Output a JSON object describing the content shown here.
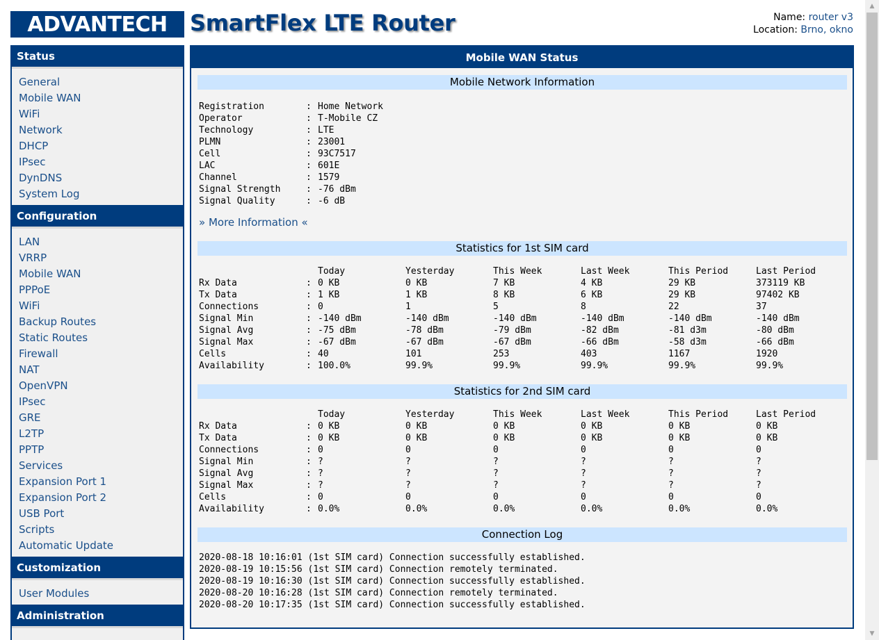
{
  "header": {
    "logo_text": "ADVANTECH",
    "app_title": "SmartFlex LTE Router",
    "name_label": "Name:",
    "name_value": "router v3",
    "location_label": "Location:",
    "location_value": "Brno, okno"
  },
  "sidebar": {
    "sections": [
      {
        "title": "Status",
        "items": [
          "General",
          "Mobile WAN",
          "WiFi",
          "Network",
          "DHCP",
          "IPsec",
          "DynDNS",
          "System Log"
        ]
      },
      {
        "title": "Configuration",
        "items": [
          "LAN",
          "VRRP",
          "Mobile WAN",
          "PPPoE",
          "WiFi",
          "Backup Routes",
          "Static Routes",
          "Firewall",
          "NAT",
          "OpenVPN",
          "IPsec",
          "GRE",
          "L2TP",
          "PPTP",
          "Services",
          "Expansion Port 1",
          "Expansion Port 2",
          "USB Port",
          "Scripts",
          "Automatic Update"
        ]
      },
      {
        "title": "Customization",
        "items": [
          "User Modules"
        ]
      },
      {
        "title": "Administration",
        "items": []
      }
    ]
  },
  "main": {
    "title": "Mobile WAN Status",
    "network_info": {
      "title": "Mobile Network Information",
      "rows": [
        {
          "label": "Registration",
          "value": "Home Network"
        },
        {
          "label": "Operator",
          "value": "T-Mobile CZ"
        },
        {
          "label": "Technology",
          "value": "LTE"
        },
        {
          "label": "PLMN",
          "value": "23001"
        },
        {
          "label": "Cell",
          "value": "93C7517"
        },
        {
          "label": "LAC",
          "value": "601E"
        },
        {
          "label": "Channel",
          "value": "1579"
        },
        {
          "label": "Signal Strength",
          "value": "-76 dBm"
        },
        {
          "label": "Signal Quality",
          "value": "-6 dB"
        }
      ],
      "more_link": "» More Information «"
    },
    "stat_columns": [
      "Today",
      "Yesterday",
      "This Week",
      "Last Week",
      "This Period",
      "Last Period"
    ],
    "sim1": {
      "title": "Statistics for 1st SIM card",
      "rows": [
        {
          "label": "Rx Data",
          "values": [
            "0 KB",
            "0 KB",
            "7 KB",
            "4 KB",
            "29 KB",
            "373119 KB"
          ]
        },
        {
          "label": "Tx Data",
          "values": [
            "1 KB",
            "1 KB",
            "8 KB",
            "6 KB",
            "29 KB",
            "97402 KB"
          ]
        },
        {
          "label": "Connections",
          "values": [
            "0",
            "1",
            "5",
            "8",
            "22",
            "37"
          ]
        },
        {
          "label": "Signal Min",
          "values": [
            "-140 dBm",
            "-140 dBm",
            "-140 dBm",
            "-140 dBm",
            "-140 dBm",
            "-140 dBm"
          ]
        },
        {
          "label": "Signal Avg",
          "values": [
            "-75 dBm",
            "-78 dBm",
            "-79 dBm",
            "-82 dBm",
            "-81 d3m",
            "-80 dBm"
          ]
        },
        {
          "label": "Signal Max",
          "values": [
            "-67 dBm",
            "-67 dBm",
            "-67 dBm",
            "-66 dBm",
            "-58 d3m",
            "-66 dBm"
          ]
        },
        {
          "label": "Cells",
          "values": [
            "40",
            "101",
            "253",
            "403",
            "1167",
            "1920"
          ]
        },
        {
          "label": "Availability",
          "values": [
            "100.0%",
            "99.9%",
            "99.9%",
            "99.9%",
            "99.9%",
            "99.9%"
          ]
        }
      ]
    },
    "sim2": {
      "title": "Statistics for 2nd SIM card",
      "rows": [
        {
          "label": "Rx Data",
          "values": [
            "0 KB",
            "0 KB",
            "0 KB",
            "0 KB",
            "0 KB",
            "0 KB"
          ]
        },
        {
          "label": "Tx Data",
          "values": [
            "0 KB",
            "0 KB",
            "0 KB",
            "0 KB",
            "0 KB",
            "0 KB"
          ]
        },
        {
          "label": "Connections",
          "values": [
            "0",
            "0",
            "0",
            "0",
            "0",
            "0"
          ]
        },
        {
          "label": "Signal Min",
          "values": [
            "?",
            "?",
            "?",
            "?",
            "?",
            "?"
          ]
        },
        {
          "label": "Signal Avg",
          "values": [
            "?",
            "?",
            "?",
            "?",
            "?",
            "?"
          ]
        },
        {
          "label": "Signal Max",
          "values": [
            "?",
            "?",
            "?",
            "?",
            "?",
            "?"
          ]
        },
        {
          "label": "Cells",
          "values": [
            "0",
            "0",
            "0",
            "0",
            "0",
            "0"
          ]
        },
        {
          "label": "Availability",
          "values": [
            "0.0%",
            "0.0%",
            "0.0%",
            "0.0%",
            "0.0%",
            "0.0%"
          ]
        }
      ]
    },
    "connection_log": {
      "title": "Connection Log",
      "entries": [
        "2020-08-18 10:16:01 (1st SIM card) Connection successfully established.",
        "2020-08-19 10:15:56 (1st SIM card) Connection remotely terminated.",
        "2020-08-19 10:16:30 (1st SIM card) Connection successfully established.",
        "2020-08-20 10:16:28 (1st SIM card) Connection remotely terminated.",
        "2020-08-20 10:17:35 (1st SIM card) Connection successfully established."
      ]
    }
  }
}
